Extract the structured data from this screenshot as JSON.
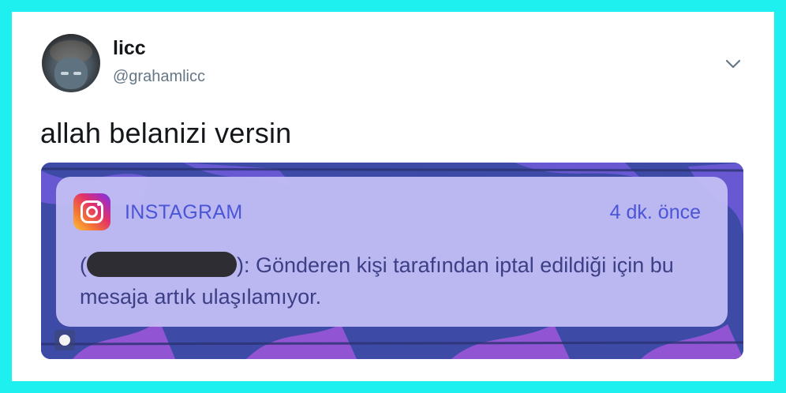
{
  "tweet": {
    "display_name": "licc",
    "handle": "@grahamlicc",
    "text": "allah belanizi versin",
    "menu_icon": "chevron-down-icon"
  },
  "notification": {
    "app_name": "INSTAGRAM",
    "time": "4 dk. önce",
    "message_open": "(",
    "message_rest": "): Gönderen kişi tarafından iptal edildiği için bu mesaja artık ulaşılamıyor.",
    "icon": "instagram-icon"
  },
  "colors": {
    "frame": "#1ef0f0",
    "notification_text": "#4a55d8",
    "notification_bg": "#c4bef4"
  }
}
